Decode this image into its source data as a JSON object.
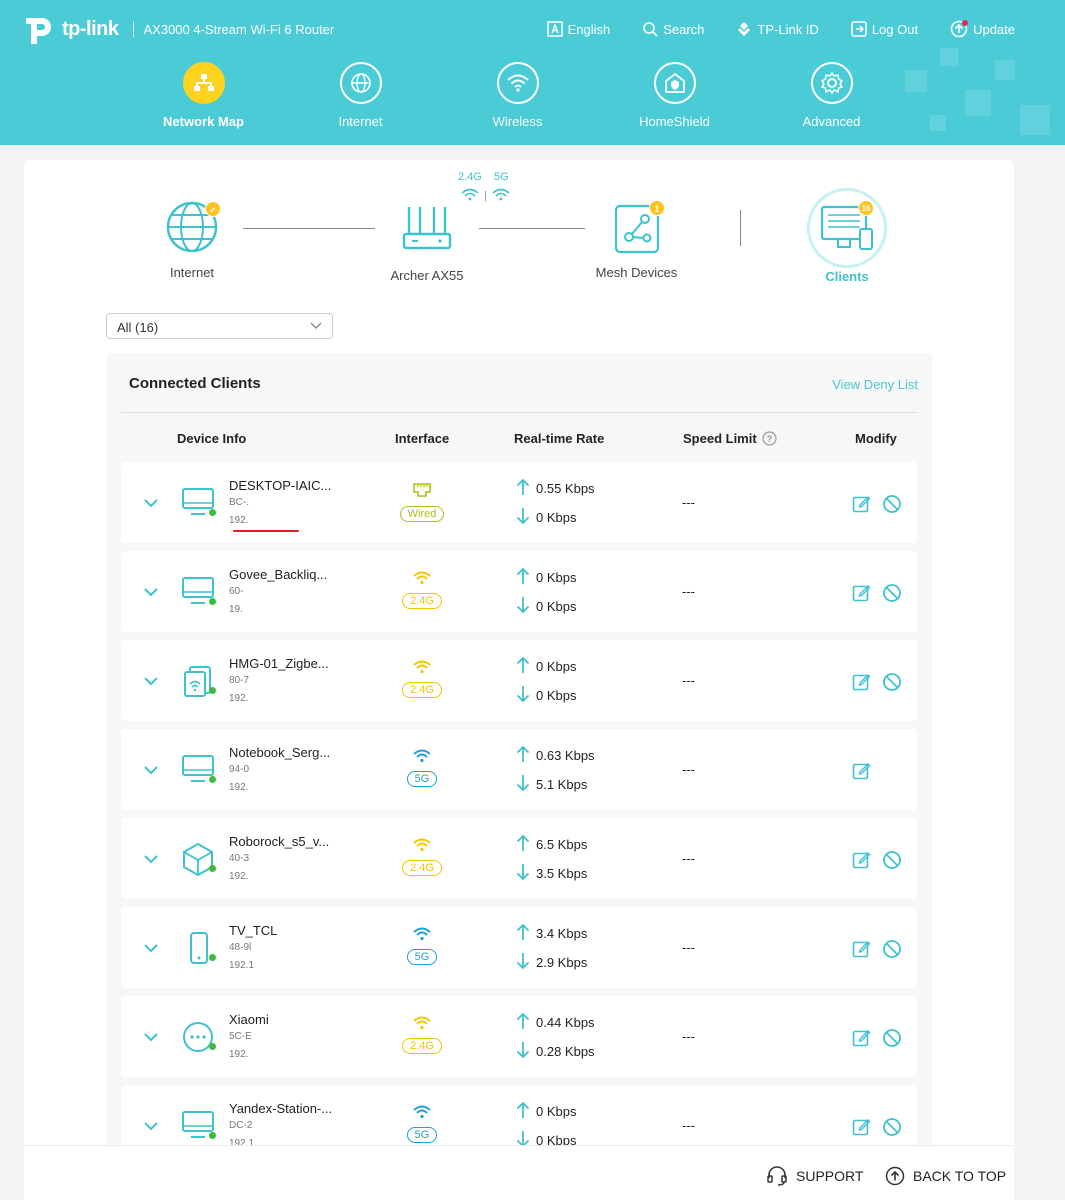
{
  "header": {
    "brand": "tp-link",
    "model": "AX3000 4-Stream Wi-Fi 6 Router",
    "top_nav": [
      {
        "label": "English",
        "icon": "language-icon"
      },
      {
        "label": "Search",
        "icon": "search-icon"
      },
      {
        "label": "TP-Link ID",
        "icon": "tplink-id-icon"
      },
      {
        "label": "Log Out",
        "icon": "logout-icon"
      },
      {
        "label": "Update",
        "icon": "update-icon"
      }
    ],
    "tabs": [
      {
        "label": "Network Map",
        "active": true
      },
      {
        "label": "Internet"
      },
      {
        "label": "Wireless"
      },
      {
        "label": "HomeShield"
      },
      {
        "label": "Advanced"
      }
    ]
  },
  "topology": {
    "internet": "Internet",
    "router": "Archer AX55",
    "band_24": "2.4G",
    "band_5": "5G",
    "band_sep": "|",
    "mesh": "Mesh Devices",
    "mesh_count": "1",
    "clients": "Clients",
    "clients_count": "16"
  },
  "filter": {
    "value": "All (16)"
  },
  "panel": {
    "title": "Connected Clients",
    "deny_link": "View Deny List",
    "columns": {
      "device": "Device Info",
      "interface": "Interface",
      "rate": "Real-time Rate",
      "limit": "Speed Limit",
      "modify": "Modify"
    }
  },
  "clients": [
    {
      "name": "DESKTOP-IAIC...",
      "mac": "BC-.",
      "ip": "192.",
      "interface": "Wired",
      "up": "0.55 Kbps",
      "down": "0 Kbps",
      "limit": "---",
      "device": "computer-icon"
    },
    {
      "name": "Govee_Backliq...",
      "mac": "60-",
      "ip": "19.",
      "interface": "2.4G",
      "up": "0 Kbps",
      "down": "0 Kbps",
      "limit": "---",
      "device": "computer-icon"
    },
    {
      "name": "HMG-01_Zigbe...",
      "mac": "80-7",
      "ip": "192.",
      "interface": "2.4G",
      "up": "0 Kbps",
      "down": "0 Kbps",
      "limit": "---",
      "device": "iot-device-icon"
    },
    {
      "name": "Notebook_Serg...",
      "mac": "94-0",
      "ip": "192.",
      "interface": "5G",
      "up": "0.63 Kbps",
      "down": "5.1 Kbps",
      "limit": "---",
      "device": "computer-icon"
    },
    {
      "name": "Roborock_s5_v...",
      "mac": "40-3",
      "ip": "192.",
      "interface": "2.4G",
      "up": "6.5 Kbps",
      "down": "3.5 Kbps",
      "limit": "---",
      "device": "cube-icon"
    },
    {
      "name": "TV_TCL",
      "mac": "48-9l",
      "ip": "192.1",
      "interface": "5G",
      "up": "3.4 Kbps",
      "down": "2.9 Kbps",
      "limit": "---",
      "device": "phone-icon"
    },
    {
      "name": "Xiaomi",
      "mac": "5C-E",
      "ip": "192.",
      "interface": "2.4G",
      "up": "0.44 Kbps",
      "down": "0.28 Kbps",
      "limit": "---",
      "device": "other-device-icon"
    },
    {
      "name": "Yandex-Station-...",
      "mac": "DC-2",
      "ip": "192.1",
      "interface": "5G",
      "up": "0 Kbps",
      "down": "0 Kbps",
      "limit": "---",
      "device": "computer-icon"
    }
  ],
  "footer": {
    "support": "SUPPORT",
    "back_to_top": "BACK TO TOP"
  },
  "colors": {
    "header": "#4acbd6",
    "accent": "#3ec2cd",
    "active_tab": "#ffd21f",
    "band_24": "#f5c400",
    "band_5": "#1f9fd6",
    "wired": "#a4c61a"
  }
}
